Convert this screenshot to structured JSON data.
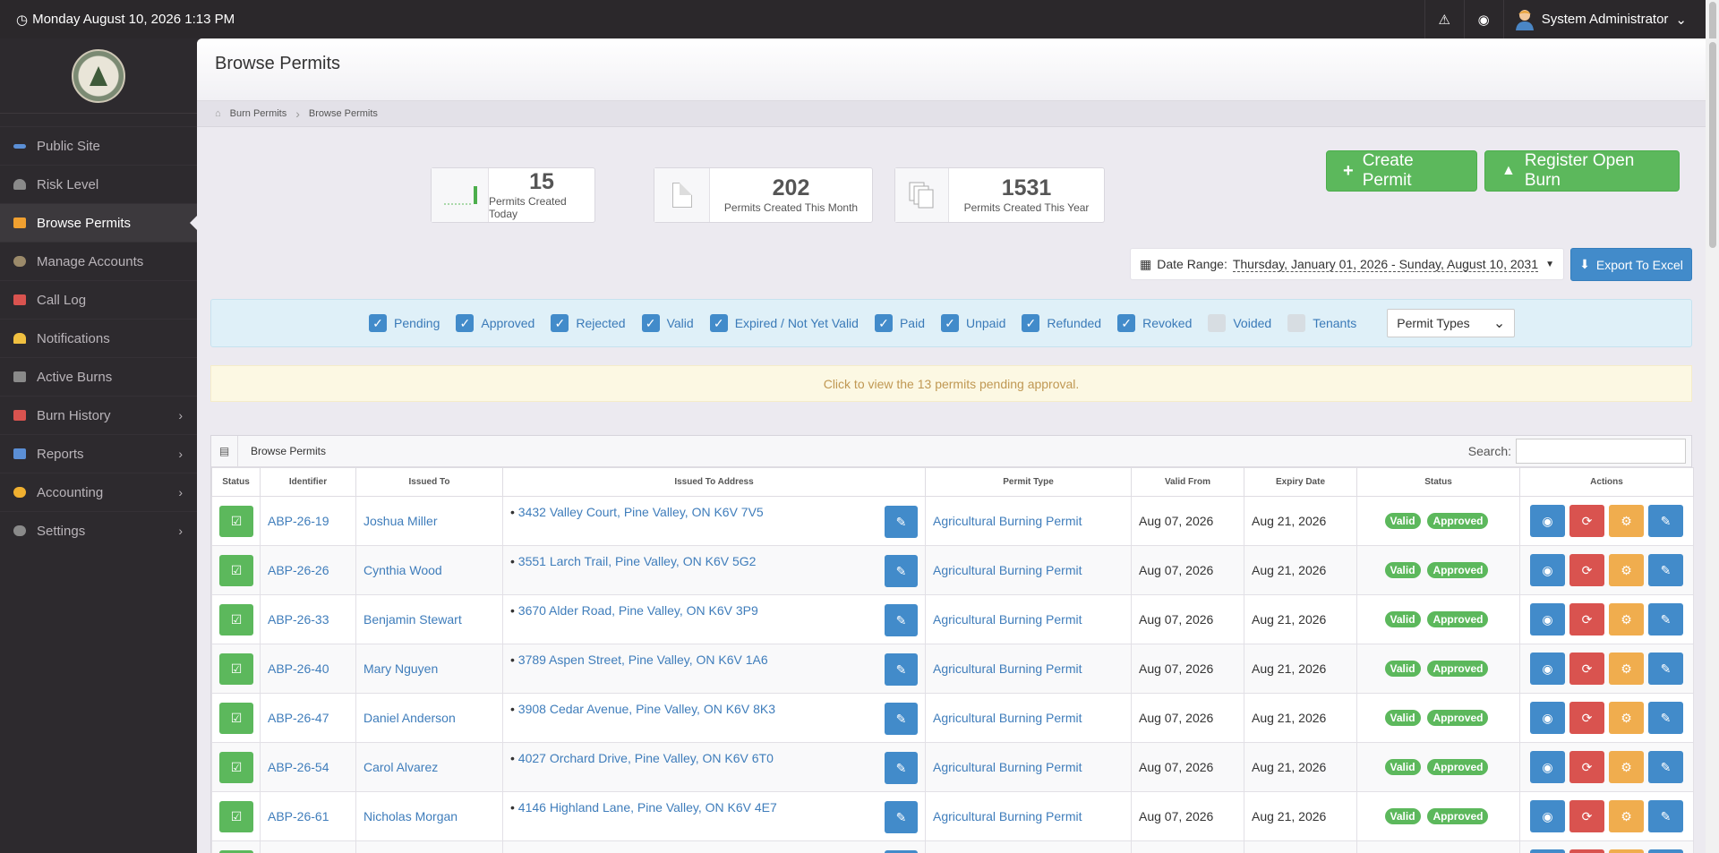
{
  "topbar": {
    "datetime": "Monday August 10, 2026 1:13 PM",
    "user": "System Administrator"
  },
  "sidebar": {
    "items": [
      {
        "label": "Public Site",
        "icon": "link-icon",
        "color": "#5b8fd6"
      },
      {
        "label": "Risk Level",
        "icon": "gauge-icon",
        "color": "#8a8a8a"
      },
      {
        "label": "Browse Permits",
        "icon": "ticket-icon",
        "color": "#f0a030"
      },
      {
        "label": "Manage Accounts",
        "icon": "users-icon",
        "color": "#9b8a6a"
      },
      {
        "label": "Call Log",
        "icon": "phone-icon",
        "color": "#d9534f"
      },
      {
        "label": "Notifications",
        "icon": "bell-icon",
        "color": "#f0c040"
      },
      {
        "label": "Active Burns",
        "icon": "chart-icon",
        "color": "#8a8a8a"
      },
      {
        "label": "Burn History",
        "icon": "calendar-icon",
        "color": "#d9534f"
      },
      {
        "label": "Reports",
        "icon": "report-icon",
        "color": "#5b8fd6"
      },
      {
        "label": "Accounting",
        "icon": "coins-icon",
        "color": "#f0b030"
      },
      {
        "label": "Settings",
        "icon": "gear-icon",
        "color": "#8a8a8a"
      }
    ]
  },
  "page": {
    "title": "Browse Permits",
    "breadcrumb": [
      "Burn Permits",
      "Browse Permits"
    ]
  },
  "stats": [
    {
      "value": "15",
      "label": "Permits Created Today"
    },
    {
      "value": "202",
      "label": "Permits Created This Month"
    },
    {
      "value": "1531",
      "label": "Permits Created This Year"
    }
  ],
  "buttons": {
    "create": "Create Permit",
    "register": "Register Open Burn",
    "export": "Export To Excel"
  },
  "daterange": {
    "label": "Date Range:",
    "value": "Thursday, January 01, 2026 - Sunday, August 10, 2031"
  },
  "filters": {
    "items": [
      {
        "label": "Pending",
        "checked": true
      },
      {
        "label": "Approved",
        "checked": true
      },
      {
        "label": "Rejected",
        "checked": true
      },
      {
        "label": "Valid",
        "checked": true
      },
      {
        "label": "Expired / Not Yet Valid",
        "checked": true
      },
      {
        "label": "Paid",
        "checked": true
      },
      {
        "label": "Unpaid",
        "checked": true
      },
      {
        "label": "Refunded",
        "checked": true
      },
      {
        "label": "Revoked",
        "checked": true
      },
      {
        "label": "Voided",
        "checked": false
      },
      {
        "label": "Tenants",
        "checked": false
      }
    ],
    "permit_types": "Permit Types"
  },
  "pending_banner": "Click to view the 13 permits pending approval.",
  "table": {
    "title": "Browse Permits",
    "search_label": "Search:",
    "columns": [
      "Status",
      "Identifier",
      "Issued To",
      "Issued To Address",
      "Permit Type",
      "Valid From",
      "Expiry Date",
      "Status",
      "Actions"
    ],
    "rows": [
      {
        "id": "ABP-26-19",
        "name": "Joshua Miller",
        "address": "3432 Valley Court, Pine Valley, ON K6V 7V5",
        "type": "Agricultural Burning Permit",
        "from": "Aug 07, 2026",
        "expiry": "Aug 21, 2026",
        "s1": "Valid",
        "s2": "Approved"
      },
      {
        "id": "ABP-26-26",
        "name": "Cynthia Wood",
        "address": "3551 Larch Trail, Pine Valley, ON K6V 5G2",
        "type": "Agricultural Burning Permit",
        "from": "Aug 07, 2026",
        "expiry": "Aug 21, 2026",
        "s1": "Valid",
        "s2": "Approved"
      },
      {
        "id": "ABP-26-33",
        "name": "Benjamin Stewart",
        "address": "3670 Alder Road, Pine Valley, ON K6V 3P9",
        "type": "Agricultural Burning Permit",
        "from": "Aug 07, 2026",
        "expiry": "Aug 21, 2026",
        "s1": "Valid",
        "s2": "Approved"
      },
      {
        "id": "ABP-26-40",
        "name": "Mary Nguyen",
        "address": "3789 Aspen Street, Pine Valley, ON K6V 1A6",
        "type": "Agricultural Burning Permit",
        "from": "Aug 07, 2026",
        "expiry": "Aug 21, 2026",
        "s1": "Valid",
        "s2": "Approved"
      },
      {
        "id": "ABP-26-47",
        "name": "Daniel Anderson",
        "address": "3908 Cedar Avenue, Pine Valley, ON K6V 8K3",
        "type": "Agricultural Burning Permit",
        "from": "Aug 07, 2026",
        "expiry": "Aug 21, 2026",
        "s1": "Valid",
        "s2": "Approved"
      },
      {
        "id": "ABP-26-54",
        "name": "Carol Alvarez",
        "address": "4027 Orchard Drive, Pine Valley, ON K6V 6T0",
        "type": "Agricultural Burning Permit",
        "from": "Aug 07, 2026",
        "expiry": "Aug 21, 2026",
        "s1": "Valid",
        "s2": "Approved"
      },
      {
        "id": "ABP-26-61",
        "name": "Nicholas Morgan",
        "address": "4146 Highland Lane, Pine Valley, ON K6V 4E7",
        "type": "Agricultural Burning Permit",
        "from": "Aug 07, 2026",
        "expiry": "Aug 21, 2026",
        "s1": "Valid",
        "s2": "Approved"
      },
      {
        "id": "",
        "name": "",
        "address": "",
        "type": "",
        "from": "",
        "expiry": "",
        "s1": "",
        "s2": ""
      }
    ]
  }
}
